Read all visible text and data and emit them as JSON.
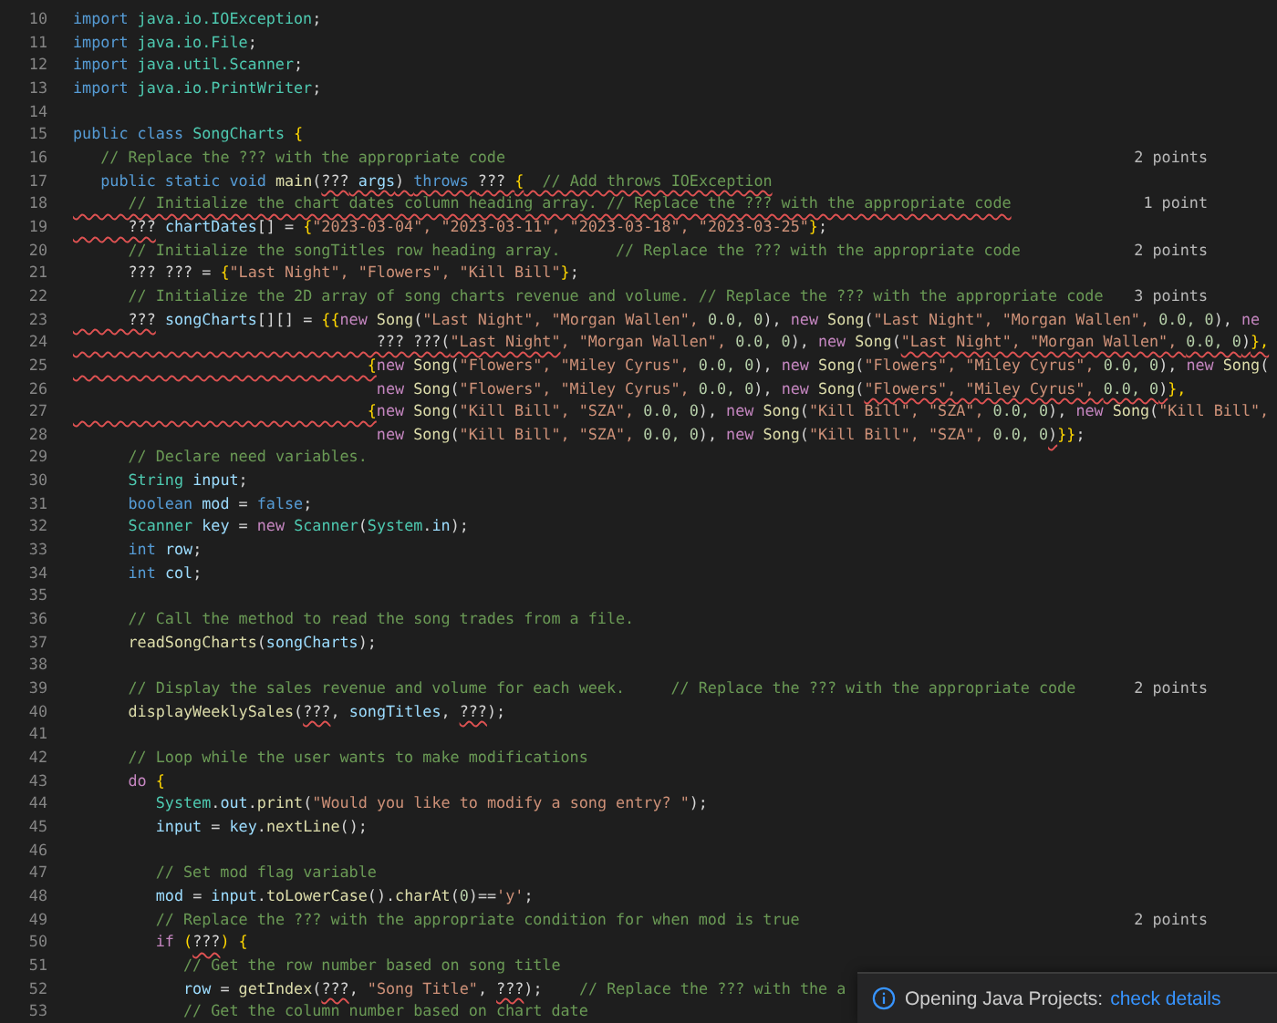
{
  "editor": {
    "lines": [
      {
        "number": "10",
        "segments": [
          {
            "text": "import ",
            "kind": "kw",
            "error": false
          },
          {
            "text": "java.io.IOException",
            "kind": "type",
            "error": false
          },
          {
            "text": ";",
            "kind": "plain",
            "error": false
          }
        ]
      },
      {
        "number": "11",
        "segments": [
          {
            "text": "import ",
            "kind": "kw",
            "error": false
          },
          {
            "text": "java.io.File",
            "kind": "type",
            "error": false
          },
          {
            "text": ";",
            "kind": "plain",
            "error": false
          }
        ]
      },
      {
        "number": "12",
        "segments": [
          {
            "text": "import ",
            "kind": "kw",
            "error": false
          },
          {
            "text": "java.util.Scanner",
            "kind": "type",
            "error": false
          },
          {
            "text": ";",
            "kind": "plain",
            "error": false
          }
        ]
      },
      {
        "number": "13",
        "segments": [
          {
            "text": "import ",
            "kind": "kw",
            "error": false
          },
          {
            "text": "java.io.PrintWriter",
            "kind": "type",
            "error": false
          },
          {
            "text": ";",
            "kind": "plain",
            "error": false
          }
        ]
      },
      {
        "number": "14"
      },
      {
        "number": "15",
        "segments": [
          {
            "text": "public class ",
            "kind": "kw",
            "error": false
          },
          {
            "text": "SongCharts",
            "kind": "type",
            "error": false
          },
          {
            "text": " {",
            "kind": "brace",
            "error": false
          }
        ]
      },
      {
        "number": "16",
        "note": "2 points",
        "segments": [
          {
            "text": "   // Replace the ??? with the appropriate code",
            "kind": "com",
            "error": false
          }
        ]
      },
      {
        "number": "17",
        "segments": [
          {
            "text": "   public static void ",
            "kind": "kw",
            "error": false
          },
          {
            "text": "main",
            "kind": "fn",
            "error": false
          },
          {
            "text": "(",
            "kind": "plain",
            "error": false
          },
          {
            "text": "???",
            "kind": "plain",
            "error": true
          },
          {
            "text": " args",
            "kind": "var",
            "error": true
          },
          {
            "text": ") ",
            "kind": "plain",
            "error": true
          },
          {
            "text": "throws ",
            "kind": "kw",
            "error": true
          },
          {
            "text": "??? ",
            "kind": "plain",
            "error": true
          },
          {
            "text": "{",
            "kind": "brace",
            "error": true
          },
          {
            "text": "  // Add throws IOException",
            "kind": "com",
            "error": true
          }
        ]
      },
      {
        "number": "18",
        "note": "1 point",
        "segments": [
          {
            "text": "      // Initialize the chart dates column heading array. // Replace the ??? with the appropriate code",
            "kind": "com",
            "error": true
          }
        ]
      },
      {
        "number": "19",
        "segments": [
          {
            "text": "      ???",
            "kind": "plain",
            "error": true
          },
          {
            "text": " chartDates",
            "kind": "var",
            "error": false
          },
          {
            "text": "[] = ",
            "kind": "plain",
            "error": false
          },
          {
            "text": "{",
            "kind": "brace",
            "error": false
          },
          {
            "text": "\"2023-03-04\", \"2023-03-11\", \"2023-03-18\", \"2023-03-25\"",
            "kind": "str",
            "error": false
          },
          {
            "text": "}",
            "kind": "brace",
            "error": false
          },
          {
            "text": ";",
            "kind": "plain",
            "error": false
          }
        ]
      },
      {
        "number": "20",
        "note": "2 points",
        "segments": [
          {
            "text": "      // Initialize the songTitles row heading array.      // Replace the ??? with the appropriate code",
            "kind": "com",
            "error": false
          }
        ]
      },
      {
        "number": "21",
        "segments": [
          {
            "text": "      ??? ??? = ",
            "kind": "plain",
            "error": false
          },
          {
            "text": "{",
            "kind": "brace",
            "error": false
          },
          {
            "text": "\"Last Night\", \"Flowers\", \"Kill Bill\"",
            "kind": "str",
            "error": false
          },
          {
            "text": "}",
            "kind": "brace",
            "error": false
          },
          {
            "text": ";",
            "kind": "plain",
            "error": false
          }
        ]
      },
      {
        "number": "22",
        "note": "3 points",
        "segments": [
          {
            "text": "      // Initialize the 2D array of song charts revenue and volume. // Replace the ??? with the appropriate code",
            "kind": "com",
            "error": false
          }
        ]
      },
      {
        "number": "23",
        "segments": [
          {
            "text": "      ???",
            "kind": "plain",
            "error": true
          },
          {
            "text": " songCharts",
            "kind": "var",
            "error": false
          },
          {
            "text": "[][] = ",
            "kind": "plain",
            "error": false
          },
          {
            "text": "{{",
            "kind": "brace",
            "error": false
          },
          {
            "text": "new ",
            "kind": "ctl",
            "error": false
          },
          {
            "text": "Song",
            "kind": "fn",
            "error": false
          },
          {
            "text": "(",
            "kind": "plain",
            "error": false
          },
          {
            "text": "\"Last Night\", \"Morgan Wallen\", ",
            "kind": "str",
            "error": false
          },
          {
            "text": "0.0, 0",
            "kind": "num",
            "error": false
          },
          {
            "text": "), ",
            "kind": "plain",
            "error": false
          },
          {
            "text": "new ",
            "kind": "ctl",
            "error": false
          },
          {
            "text": "Song",
            "kind": "fn",
            "error": false
          },
          {
            "text": "(",
            "kind": "plain",
            "error": false
          },
          {
            "text": "\"Last Night\", \"Morgan Wallen\", ",
            "kind": "str",
            "error": false
          },
          {
            "text": "0.0, 0",
            "kind": "num",
            "error": false
          },
          {
            "text": "), ",
            "kind": "plain",
            "error": false
          },
          {
            "text": "ne",
            "kind": "ctl",
            "error": false
          }
        ]
      },
      {
        "number": "24",
        "segments": [
          {
            "text": "                                 ??? ???(",
            "kind": "plain",
            "error": true
          },
          {
            "text": "\"Last Night\"",
            "kind": "str",
            "error": true
          },
          {
            "text": ", \"Morgan Wallen\", ",
            "kind": "str",
            "error": false
          },
          {
            "text": "0.0, 0",
            "kind": "num",
            "error": false
          },
          {
            "text": "), ",
            "kind": "plain",
            "error": false
          },
          {
            "text": "new ",
            "kind": "ctl",
            "error": false
          },
          {
            "text": "Song",
            "kind": "fn",
            "error": false
          },
          {
            "text": "(",
            "kind": "plain",
            "error": false
          },
          {
            "text": "\"Last Night\", \"Morgan Wallen\", ",
            "kind": "str",
            "error": true
          },
          {
            "text": "0.0, 0",
            "kind": "num",
            "error": true
          },
          {
            "text": ")",
            "kind": "plain",
            "error": true
          },
          {
            "text": "},",
            "kind": "brace",
            "error": true
          }
        ]
      },
      {
        "number": "25",
        "segments": [
          {
            "text": "                                {",
            "kind": "brace",
            "error": true
          },
          {
            "text": "new ",
            "kind": "ctl",
            "error": false
          },
          {
            "text": "Song",
            "kind": "fn",
            "error": false
          },
          {
            "text": "(",
            "kind": "plain",
            "error": false
          },
          {
            "text": "\"Flowers\", \"Miley Cyrus\", ",
            "kind": "str",
            "error": false
          },
          {
            "text": "0.0, 0",
            "kind": "num",
            "error": false
          },
          {
            "text": "), ",
            "kind": "plain",
            "error": false
          },
          {
            "text": "new ",
            "kind": "ctl",
            "error": false
          },
          {
            "text": "Song",
            "kind": "fn",
            "error": false
          },
          {
            "text": "(",
            "kind": "plain",
            "error": false
          },
          {
            "text": "\"Flowers\", \"Miley Cyrus\", ",
            "kind": "str",
            "error": false
          },
          {
            "text": "0.0, 0",
            "kind": "num",
            "error": false
          },
          {
            "text": "), ",
            "kind": "plain",
            "error": false
          },
          {
            "text": "new ",
            "kind": "ctl",
            "error": false
          },
          {
            "text": "Song",
            "kind": "fn",
            "error": false
          },
          {
            "text": "(",
            "kind": "plain",
            "error": false
          }
        ]
      },
      {
        "number": "26",
        "segments": [
          {
            "text": "                                 new ",
            "kind": "ctl",
            "error": false
          },
          {
            "text": "Song",
            "kind": "fn",
            "error": false
          },
          {
            "text": "(",
            "kind": "plain",
            "error": false
          },
          {
            "text": "\"Flowers\", \"Miley Cyrus\", ",
            "kind": "str",
            "error": false
          },
          {
            "text": "0.0, 0",
            "kind": "num",
            "error": false
          },
          {
            "text": "), ",
            "kind": "plain",
            "error": false
          },
          {
            "text": "new ",
            "kind": "ctl",
            "error": false
          },
          {
            "text": "Song",
            "kind": "fn",
            "error": false
          },
          {
            "text": "(",
            "kind": "plain",
            "error": false
          },
          {
            "text": "\"Flowers\", \"Miley Cyrus\", ",
            "kind": "str",
            "error": true
          },
          {
            "text": "0.0, 0",
            "kind": "num",
            "error": true
          },
          {
            "text": ")",
            "kind": "plain",
            "error": true
          },
          {
            "text": "},",
            "kind": "brace",
            "error": false
          }
        ]
      },
      {
        "number": "27",
        "segments": [
          {
            "text": "                                {",
            "kind": "brace",
            "error": true
          },
          {
            "text": "new ",
            "kind": "ctl",
            "error": false
          },
          {
            "text": "Song",
            "kind": "fn",
            "error": false
          },
          {
            "text": "(",
            "kind": "plain",
            "error": false
          },
          {
            "text": "\"Kill Bill\", \"SZA\", ",
            "kind": "str",
            "error": false
          },
          {
            "text": "0.0, 0",
            "kind": "num",
            "error": false
          },
          {
            "text": "), ",
            "kind": "plain",
            "error": false
          },
          {
            "text": "new ",
            "kind": "ctl",
            "error": false
          },
          {
            "text": "Song",
            "kind": "fn",
            "error": false
          },
          {
            "text": "(",
            "kind": "plain",
            "error": false
          },
          {
            "text": "\"Kill Bill\", \"SZA\", ",
            "kind": "str",
            "error": false
          },
          {
            "text": "0.0, 0",
            "kind": "num",
            "error": false
          },
          {
            "text": "), ",
            "kind": "plain",
            "error": false
          },
          {
            "text": "new ",
            "kind": "ctl",
            "error": false
          },
          {
            "text": "Song",
            "kind": "fn",
            "error": false
          },
          {
            "text": "(",
            "kind": "plain",
            "error": false
          },
          {
            "text": "\"Kill Bill\",",
            "kind": "str",
            "error": false
          }
        ]
      },
      {
        "number": "28",
        "segments": [
          {
            "text": "                                 new ",
            "kind": "ctl",
            "error": false
          },
          {
            "text": "Song",
            "kind": "fn",
            "error": false
          },
          {
            "text": "(",
            "kind": "plain",
            "error": false
          },
          {
            "text": "\"Kill Bill\", \"SZA\", ",
            "kind": "str",
            "error": false
          },
          {
            "text": "0.0, 0",
            "kind": "num",
            "error": false
          },
          {
            "text": "), ",
            "kind": "plain",
            "error": false
          },
          {
            "text": "new ",
            "kind": "ctl",
            "error": false
          },
          {
            "text": "Song",
            "kind": "fn",
            "error": false
          },
          {
            "text": "(",
            "kind": "plain",
            "error": false
          },
          {
            "text": "\"Kill Bill\", \"SZA\", ",
            "kind": "str",
            "error": false
          },
          {
            "text": "0.0, 0",
            "kind": "num",
            "error": false
          },
          {
            "text": ")",
            "kind": "plain",
            "error": true
          },
          {
            "text": "}}",
            "kind": "brace",
            "error": false
          },
          {
            "text": ";",
            "kind": "plain",
            "error": false
          }
        ]
      },
      {
        "number": "29",
        "segments": [
          {
            "text": "      // Declare need variables.",
            "kind": "com",
            "error": false
          }
        ]
      },
      {
        "number": "30",
        "segments": [
          {
            "text": "      String",
            "kind": "type",
            "error": false
          },
          {
            "text": " input",
            "kind": "var",
            "error": false
          },
          {
            "text": ";",
            "kind": "plain",
            "error": false
          }
        ]
      },
      {
        "number": "31",
        "segments": [
          {
            "text": "      boolean ",
            "kind": "kw",
            "error": false
          },
          {
            "text": "mod",
            "kind": "var",
            "error": false
          },
          {
            "text": " = ",
            "kind": "plain",
            "error": false
          },
          {
            "text": "false",
            "kind": "kw",
            "error": false
          },
          {
            "text": ";",
            "kind": "plain",
            "error": false
          }
        ]
      },
      {
        "number": "32",
        "segments": [
          {
            "text": "      Scanner",
            "kind": "type",
            "error": false
          },
          {
            "text": " key",
            "kind": "var",
            "error": false
          },
          {
            "text": " = ",
            "kind": "plain",
            "error": false
          },
          {
            "text": "new ",
            "kind": "ctl",
            "error": false
          },
          {
            "text": "Scanner",
            "kind": "type",
            "error": false
          },
          {
            "text": "(",
            "kind": "plain",
            "error": false
          },
          {
            "text": "System",
            "kind": "type",
            "error": false
          },
          {
            "text": ".",
            "kind": "plain",
            "error": false
          },
          {
            "text": "in",
            "kind": "var",
            "error": false
          },
          {
            "text": ");",
            "kind": "plain",
            "error": false
          }
        ]
      },
      {
        "number": "33",
        "segments": [
          {
            "text": "      int ",
            "kind": "kw",
            "error": false
          },
          {
            "text": "row",
            "kind": "var",
            "error": false
          },
          {
            "text": ";",
            "kind": "plain",
            "error": false
          }
        ]
      },
      {
        "number": "34",
        "segments": [
          {
            "text": "      int ",
            "kind": "kw",
            "error": false
          },
          {
            "text": "col",
            "kind": "var",
            "error": false
          },
          {
            "text": ";",
            "kind": "plain",
            "error": false
          }
        ]
      },
      {
        "number": "35"
      },
      {
        "number": "36",
        "segments": [
          {
            "text": "      // Call the method to read the song trades from a file.",
            "kind": "com",
            "error": false
          }
        ]
      },
      {
        "number": "37",
        "segments": [
          {
            "text": "      readSongCharts",
            "kind": "fn",
            "error": false
          },
          {
            "text": "(",
            "kind": "plain",
            "error": false
          },
          {
            "text": "songCharts",
            "kind": "var",
            "error": false
          },
          {
            "text": ");",
            "kind": "plain",
            "error": false
          }
        ]
      },
      {
        "number": "38"
      },
      {
        "number": "39",
        "note": "2 points",
        "segments": [
          {
            "text": "      // Display the sales revenue and volume for each week.     // Replace the ??? with the appropriate code",
            "kind": "com",
            "error": false
          }
        ]
      },
      {
        "number": "40",
        "segments": [
          {
            "text": "      displayWeeklySales",
            "kind": "fn",
            "error": false
          },
          {
            "text": "(",
            "kind": "plain",
            "error": false
          },
          {
            "text": "???",
            "kind": "plain",
            "error": true
          },
          {
            "text": ", ",
            "kind": "plain",
            "error": false
          },
          {
            "text": "songTitles",
            "kind": "var",
            "error": false
          },
          {
            "text": ", ",
            "kind": "plain",
            "error": false
          },
          {
            "text": "???",
            "kind": "plain",
            "error": true
          },
          {
            "text": ");",
            "kind": "plain",
            "error": false
          }
        ]
      },
      {
        "number": "41"
      },
      {
        "number": "42",
        "segments": [
          {
            "text": "      // Loop while the user wants to make modifications",
            "kind": "com",
            "error": false
          }
        ]
      },
      {
        "number": "43",
        "segments": [
          {
            "text": "      do ",
            "kind": "ctl",
            "error": false
          },
          {
            "text": "{",
            "kind": "brace",
            "error": false
          }
        ]
      },
      {
        "number": "44",
        "segments": [
          {
            "text": "         System",
            "kind": "type",
            "error": false
          },
          {
            "text": ".",
            "kind": "plain",
            "error": false
          },
          {
            "text": "out",
            "kind": "var",
            "error": false
          },
          {
            "text": ".",
            "kind": "plain",
            "error": false
          },
          {
            "text": "print",
            "kind": "fn",
            "error": false
          },
          {
            "text": "(",
            "kind": "plain",
            "error": false
          },
          {
            "text": "\"Would you like to modify a song entry? \"",
            "kind": "str",
            "error": false
          },
          {
            "text": ");",
            "kind": "plain",
            "error": false
          }
        ]
      },
      {
        "number": "45",
        "segments": [
          {
            "text": "         input",
            "kind": "var",
            "error": false
          },
          {
            "text": " = ",
            "kind": "plain",
            "error": false
          },
          {
            "text": "key",
            "kind": "var",
            "error": false
          },
          {
            "text": ".",
            "kind": "plain",
            "error": false
          },
          {
            "text": "nextLine",
            "kind": "fn",
            "error": false
          },
          {
            "text": "();",
            "kind": "plain",
            "error": false
          }
        ]
      },
      {
        "number": "46"
      },
      {
        "number": "47",
        "segments": [
          {
            "text": "         // Set mod flag variable",
            "kind": "com",
            "error": false
          }
        ]
      },
      {
        "number": "48",
        "segments": [
          {
            "text": "         mod",
            "kind": "var",
            "error": false
          },
          {
            "text": " = ",
            "kind": "plain",
            "error": false
          },
          {
            "text": "input",
            "kind": "var",
            "error": false
          },
          {
            "text": ".",
            "kind": "plain",
            "error": false
          },
          {
            "text": "toLowerCase",
            "kind": "fn",
            "error": false
          },
          {
            "text": "().",
            "kind": "plain",
            "error": false
          },
          {
            "text": "charAt",
            "kind": "fn",
            "error": false
          },
          {
            "text": "(",
            "kind": "plain",
            "error": false
          },
          {
            "text": "0",
            "kind": "num",
            "error": false
          },
          {
            "text": ")==",
            "kind": "plain",
            "error": false
          },
          {
            "text": "'y'",
            "kind": "str",
            "error": false
          },
          {
            "text": ";",
            "kind": "plain",
            "error": false
          }
        ]
      },
      {
        "number": "49",
        "note": "2 points",
        "segments": [
          {
            "text": "         // Replace the ??? with the appropriate condition for when mod is true",
            "kind": "com",
            "error": false
          }
        ]
      },
      {
        "number": "50",
        "segments": [
          {
            "text": "         if ",
            "kind": "ctl",
            "error": false
          },
          {
            "text": "(",
            "kind": "brace",
            "error": false
          },
          {
            "text": "???",
            "kind": "plain",
            "error": true
          },
          {
            "text": ") {",
            "kind": "brace",
            "error": false
          }
        ]
      },
      {
        "number": "51",
        "segments": [
          {
            "text": "            // Get the row number based on song title",
            "kind": "com",
            "error": false
          }
        ]
      },
      {
        "number": "52",
        "segments": [
          {
            "text": "            row",
            "kind": "var",
            "error": false
          },
          {
            "text": " = ",
            "kind": "plain",
            "error": false
          },
          {
            "text": "getIndex",
            "kind": "fn",
            "error": false
          },
          {
            "text": "(",
            "kind": "plain",
            "error": false
          },
          {
            "text": "???",
            "kind": "plain",
            "error": true
          },
          {
            "text": ", ",
            "kind": "plain",
            "error": false
          },
          {
            "text": "\"Song Title\"",
            "kind": "str",
            "error": false
          },
          {
            "text": ", ",
            "kind": "plain",
            "error": false
          },
          {
            "text": "???",
            "kind": "plain",
            "error": true
          },
          {
            "text": ");",
            "kind": "plain",
            "error": false
          },
          {
            "text": "    // Replace the ??? with the a",
            "kind": "com",
            "error": false
          }
        ]
      },
      {
        "number": "53",
        "segments": [
          {
            "text": "            // Get the column number based on chart date",
            "kind": "com",
            "error": false
          }
        ]
      }
    ]
  },
  "notification": {
    "message": "Opening Java Projects:",
    "link": "check details"
  }
}
